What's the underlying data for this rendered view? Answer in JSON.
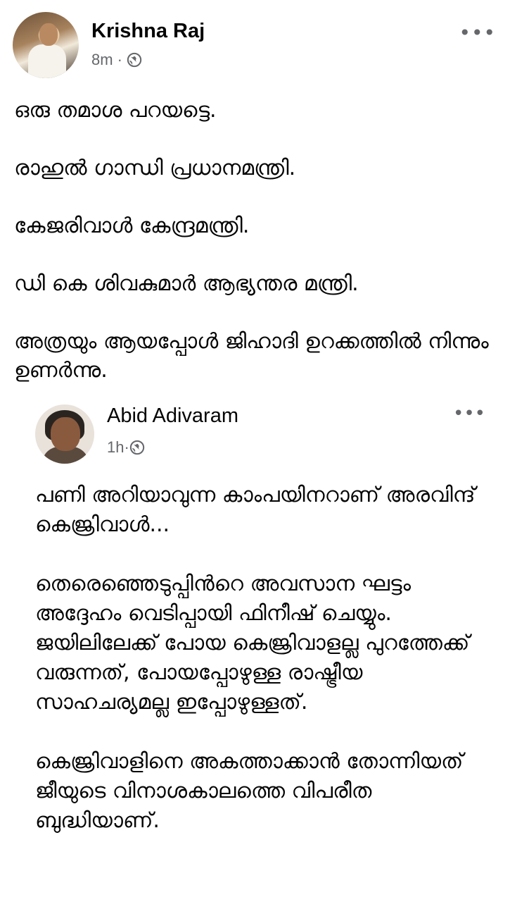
{
  "post": {
    "author": "Krishna Raj",
    "time": "8m",
    "dot": "·",
    "more": "•••",
    "paragraphs": [
      "ഒരു തമാശ പറയട്ടെ.",
      "രാഹുൽ ഗാന്ധി പ്രധാനമന്ത്രി.",
      "കേജരിവാൾ കേന്ദ്രമന്ത്രി.",
      "ഡി കെ ശിവകുമാർ ആഭ്യന്തര മന്ത്രി.",
      "അത്രയും ആയപ്പോൾ ജിഹാദി ഉറക്കത്തിൽ നിന്നും ഉണർന്നു."
    ]
  },
  "shared_post": {
    "author": "Abid Adivaram",
    "time": "1h",
    "dot": "·",
    "more": "•••",
    "paragraphs": [
      "പണി അറിയാവുന്ന കാംപയിനറാണ് അരവിന്ദ് കെജ്രിവാൾ...",
      "തെരെഞ്ഞെടുപ്പിൻറെ അവസാന ഘട്ടം അദ്ദേഹം വെടിപ്പായി ഫിനീഷ് ചെയ്യും. ജയിലിലേക്ക് പോയ കെജ്രിവാളല്ല പുറത്തേക്ക് വരുന്നത്, പോയപ്പോഴുള്ള രാഷ്ട്രീയ സാഹചര്യമല്ല ഇപ്പോഴുള്ളത്.",
      "കെജ്രിവാളിനെ അകത്താക്കാൻ തോന്നിയത് ജീയുടെ വിനാശകാലത്തെ വിപരീത ബുദ്ധിയാണ്."
    ]
  }
}
